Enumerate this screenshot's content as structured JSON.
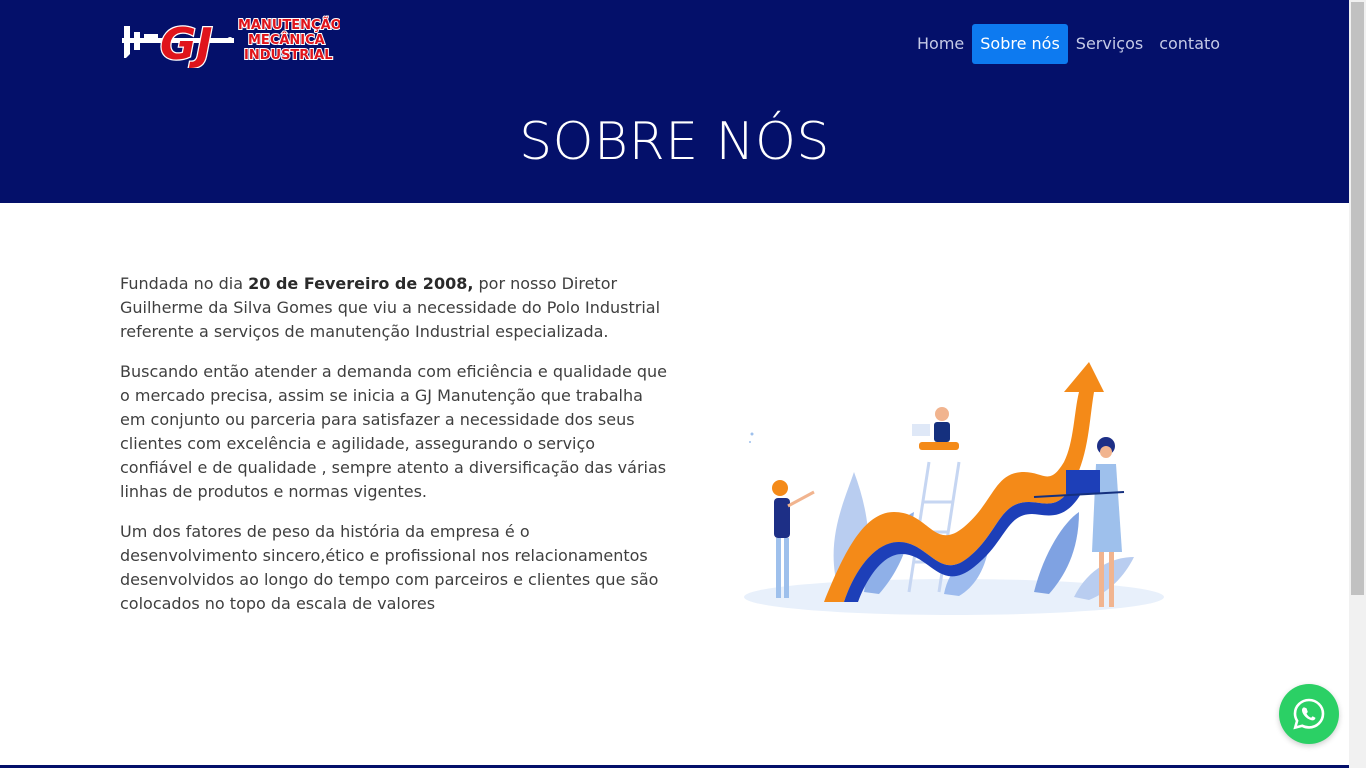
{
  "brand": {
    "logo_letters": "GJ",
    "logo_text_lines": [
      "MANUTENÇÃO",
      "MECÂNICA",
      "INDUSTRIAL"
    ]
  },
  "nav": {
    "items": [
      {
        "label": "Home",
        "active": false
      },
      {
        "label": "Sobre nós",
        "active": true
      },
      {
        "label": "Serviços",
        "active": false
      },
      {
        "label": "contato",
        "active": false
      }
    ]
  },
  "hero": {
    "title": "SOBRE NÓS"
  },
  "about": {
    "p1_pre": "Fundada no dia ",
    "p1_bold": "20 de Fevereiro de 2008,",
    "p1_post": " por nosso Diretor Guilherme da Silva Gomes que viu a necessidade do Polo Industrial referente a serviços de manutenção Industrial especializada.",
    "p2": "Buscando então atender a demanda com eficiência e qualidade que o mercado precisa, assim se inicia a GJ Manutenção que trabalha em conjunto ou parceria para satisfazer a necessidade dos seus clientes com excelência e agilidade, assegurando o serviço confiável e de qualidade , sempre atento a diversificação das várias linhas de produtos e normas vigentes.",
    "p3": "Um dos fatores de peso da história da empresa é o desenvolvimento sincero,ético e profissional nos relacionamentos desenvolvidos ao longo do tempo com parceiros e clientes que são colocados no topo da escala de valores"
  },
  "colors": {
    "header_bg": "#04106a",
    "nav_active_bg": "#0d7af0",
    "logo_red": "#e0141b",
    "whatsapp_green": "#2bd065"
  },
  "icons": {
    "whatsapp": "whatsapp-icon",
    "logo": "gj-logo"
  }
}
